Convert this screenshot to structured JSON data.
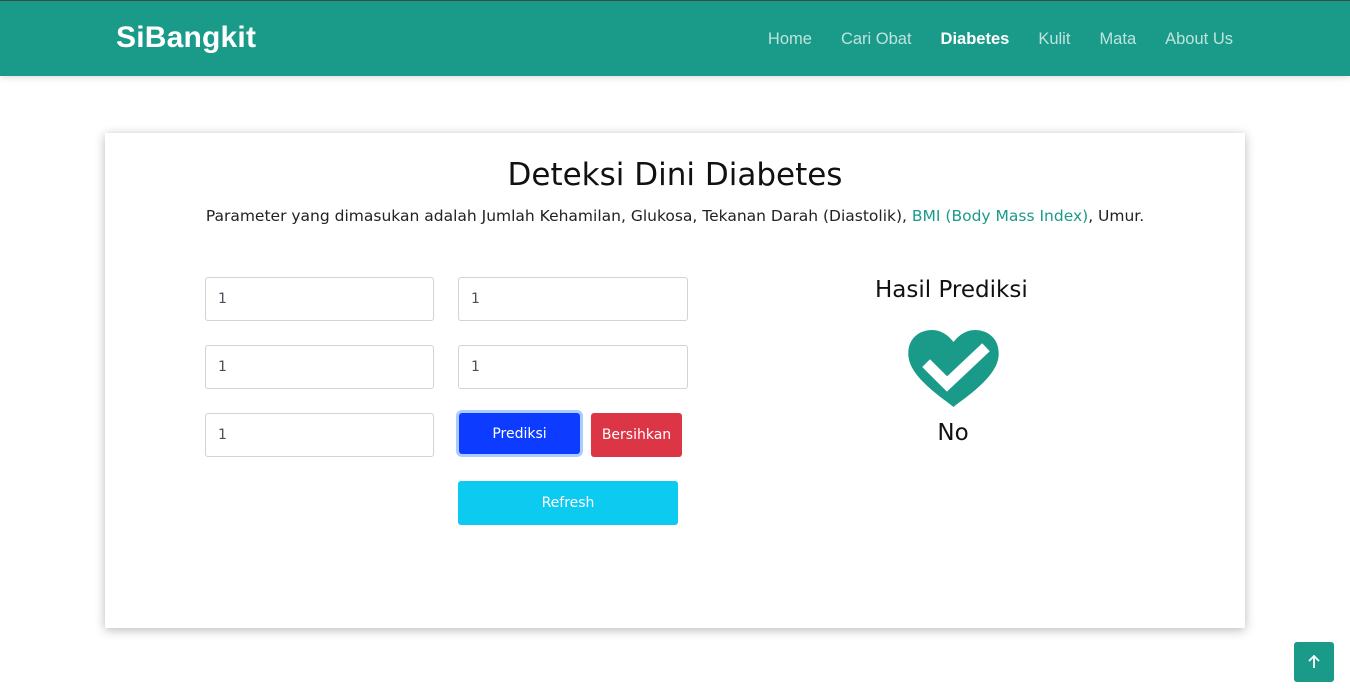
{
  "header": {
    "brand": "SiBangkit",
    "nav": [
      {
        "label": "Home",
        "active": false
      },
      {
        "label": "Cari Obat",
        "active": false
      },
      {
        "label": "Diabetes",
        "active": true
      },
      {
        "label": "Kulit",
        "active": false
      },
      {
        "label": "Mata",
        "active": false
      },
      {
        "label": "About Us",
        "active": false
      }
    ]
  },
  "main": {
    "title": "Deteksi Dini Diabetes",
    "description_prefix": "Parameter yang dimasukan adalah Jumlah Kehamilan, Glukosa, Tekanan Darah (Diastolik), ",
    "description_link": "BMI (Body Mass Index)",
    "description_suffix": ", Umur.",
    "fields": [
      {
        "value": "1"
      },
      {
        "value": "1"
      },
      {
        "value": "1"
      },
      {
        "value": "1"
      },
      {
        "value": "1"
      }
    ],
    "buttons": {
      "predict": "Prediksi",
      "clear": "Bersihkan",
      "refresh": "Refresh"
    },
    "result": {
      "title": "Hasil Prediksi",
      "value": "No",
      "icon": "heart-check-icon"
    }
  },
  "scroll_top": {
    "icon": "arrow-up-icon"
  },
  "colors": {
    "brand": "#1a9b8a",
    "primary": "#0d3bff",
    "danger": "#dc3545",
    "info": "#0dcaf0"
  }
}
